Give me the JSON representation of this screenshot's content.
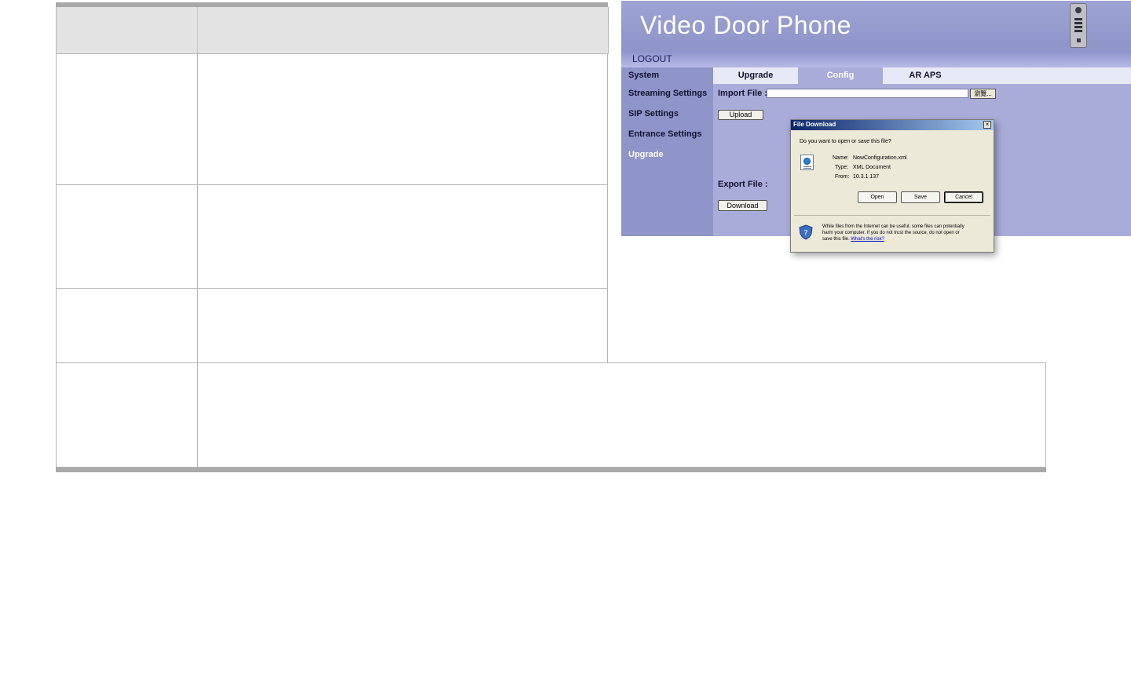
{
  "screenshot": {
    "title": "Video Door Phone",
    "logout": "LOGOUT",
    "sidebar": [
      "System",
      "Streaming Settings",
      "SIP Settings",
      "Entrance Settings",
      "Upgrade"
    ],
    "sidebar_active": "Upgrade",
    "tabs": [
      "Upgrade",
      "Config",
      "AR APS"
    ],
    "tab_active": "Config",
    "import_label": "Import File :",
    "browse_label": "瀏覽...",
    "upload_label": "Upload",
    "export_label": "Export File :",
    "download_label": "Download"
  },
  "dialog": {
    "title": "File Download",
    "question": "Do you want to open or save this file?",
    "name_label": "Name:",
    "name_value": "NowConfiguration.xml",
    "type_label": "Type:",
    "type_value": "XML Document",
    "from_label": "From:",
    "from_value": "10.3.1.137",
    "open_label": "Open",
    "save_label": "Save",
    "cancel_label": "Cancel",
    "close_label": "×",
    "warning_line1": "While files from the Internet can be useful, some files can potentially",
    "warning_line2": "harm your computer. If you do not trust the source, do not open or",
    "warning_line3": "save this file.",
    "risk_link": "What's the risk?"
  },
  "colors": {
    "panel_bg": "#a9abd8",
    "sidebar_bg": "#8f94c9",
    "table_border": "#b5b5b5",
    "table_header_bg": "#e3e3e3"
  }
}
